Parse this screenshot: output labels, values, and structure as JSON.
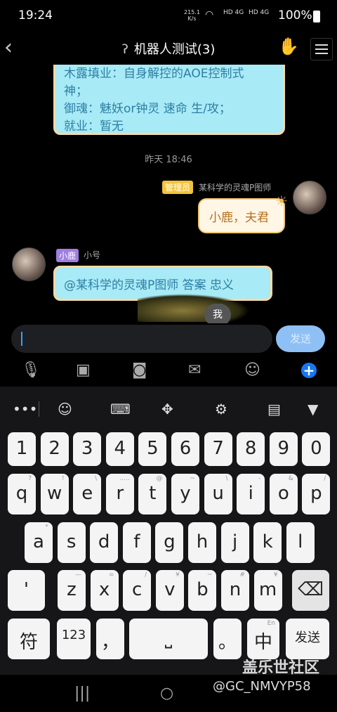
{
  "status_bar": {
    "time": "19:24",
    "net_speed_value": "215.1",
    "net_speed_unit": "K/s",
    "signal_1": "HD 4G",
    "signal_2": "HD 4G",
    "battery": "100%"
  },
  "header": {
    "title": "机器人测试(3)",
    "back_icon": "chevron-left-icon",
    "ear_icon": "ear-icon",
    "hand_icon": "hand-icon",
    "menu_icon": "menu-icon"
  },
  "chat": {
    "top_bubble_lines": [
      "木露填业：自身解控的AOE控制式",
      "神；",
      "御魂：魅妖or钟灵 速命 生/攻；",
      "就业：暂无"
    ],
    "timestamp": "昨天 18:46",
    "msg_right": {
      "badge": "管理员",
      "sender": "某科学的灵魂P图师",
      "text": "小鹿，夫君"
    },
    "msg_left": {
      "badge": "小鹿",
      "sender": "小号",
      "text": "@某科学的灵魂P图师 答案   忠义"
    },
    "me_bubble": "我"
  },
  "input": {
    "send_label": "发送"
  },
  "toolbar": [
    "mic-icon",
    "image-icon",
    "camera-icon",
    "mail-icon",
    "emoji-icon",
    "plus-icon"
  ],
  "keyboard": {
    "tools": [
      "more-icon",
      "emoji-icon",
      "keyboard-icon",
      "move-icon",
      "settings-icon",
      "clipboard-icon",
      "collapse-icon"
    ],
    "row_numbers": [
      "1",
      "2",
      "3",
      "4",
      "5",
      "6",
      "7",
      "8",
      "9",
      "0"
    ],
    "row_q": [
      [
        "q",
        "?"
      ],
      [
        "w",
        "!"
      ],
      [
        "e",
        "\\"
      ],
      [
        "r",
        "....."
      ],
      [
        "t",
        "@"
      ],
      [
        "y",
        "~"
      ],
      [
        "u",
        "\\"
      ],
      [
        "i",
        "-"
      ],
      [
        "o",
        "&"
      ],
      [
        "p",
        "/"
      ]
    ],
    "row_a": [
      [
        "a",
        "*"
      ],
      [
        "s",
        ""
      ],
      [
        "d",
        ""
      ],
      [
        "f",
        ""
      ],
      [
        "g",
        ""
      ],
      [
        "h",
        ""
      ],
      [
        "j",
        ""
      ],
      [
        "k",
        ""
      ],
      [
        "l",
        ""
      ]
    ],
    "row_z": [
      [
        "'",
        ""
      ],
      [
        "z",
        "—"
      ],
      [
        "x",
        "="
      ],
      [
        "c",
        "/"
      ],
      [
        "v",
        "¥"
      ],
      [
        "b",
        "~"
      ],
      [
        "n",
        "#"
      ],
      [
        "m",
        "¥"
      ]
    ],
    "bottom": {
      "fu": "符",
      "num": "123",
      "comma": "，",
      "period": "。",
      "zh": "中",
      "en": "En",
      "send": "发送"
    }
  },
  "nav": {
    "recents": "|||",
    "home": "○"
  },
  "watermark": {
    "site": "盖乐世社区",
    "user": "@GC_NMVYP58"
  }
}
